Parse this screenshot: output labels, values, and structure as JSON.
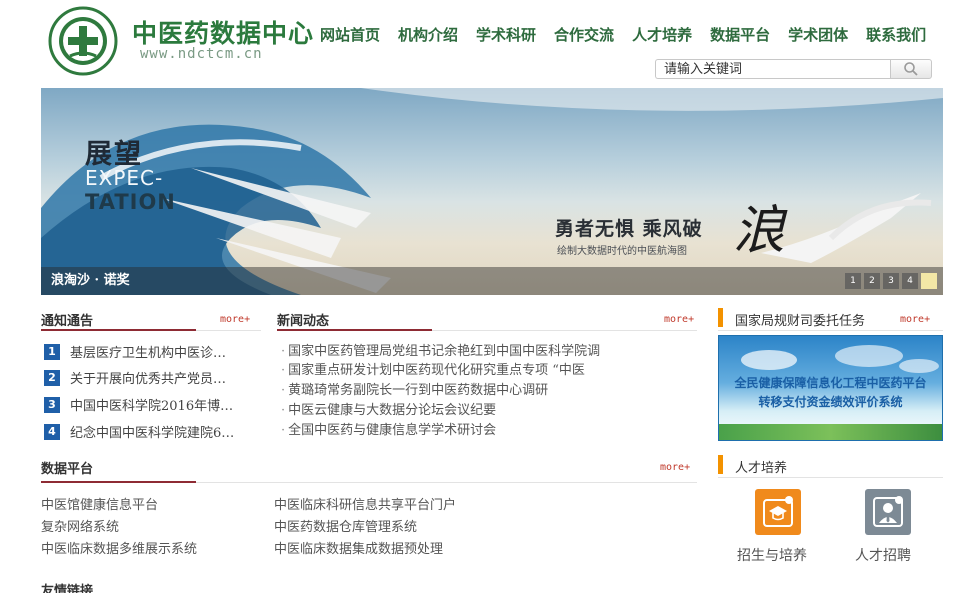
{
  "site": {
    "name": "中医药数据中心",
    "url": "www.ndctcm.cn"
  },
  "nav": [
    "网站首页",
    "机构介绍",
    "学术科研",
    "合作交流",
    "人才培养",
    "数据平台",
    "学术团体",
    "联系我们"
  ],
  "search": {
    "placeholder": "请输入关键词"
  },
  "banner": {
    "title_zh": "展望",
    "title_en_1": "EXPEC-",
    "title_en_2": "TATION",
    "slogan": "勇者无惧 乘风破",
    "callig": "浪",
    "subtitle": "绘制大数据时代的中医航海图",
    "caption": "浪淘沙 · 诺奖",
    "pages": [
      "1",
      "2",
      "3",
      "4",
      ""
    ],
    "active_page_index": 4
  },
  "notices": {
    "title": "通知通告",
    "more": "more+",
    "items": [
      {
        "num": "1",
        "text": "基层医疗卫生机构中医诊…"
      },
      {
        "num": "2",
        "text": "关于开展向优秀共产党员…"
      },
      {
        "num": "3",
        "text": "中国中医科学院2016年博…"
      },
      {
        "num": "4",
        "text": "纪念中国中医科学院建院6…"
      }
    ]
  },
  "news": {
    "title": "新闻动态",
    "more": "more+",
    "items": [
      "国家中医药管理局党组书记余艳红到中国中医科学院调",
      "国家重点研发计划中医药现代化研究重点专项 “中医",
      "黄璐琦常务副院长一行到中医药数据中心调研",
      "中医云健康与大数据分论坛会议纪要",
      "全国中医药与健康信息学学术研讨会"
    ]
  },
  "platforms": {
    "title": "数据平台",
    "more": "more+",
    "left": [
      "中医馆健康信息平台",
      "复杂网络系统",
      "中医临床数据多维展示系统"
    ],
    "right": [
      "中医临床科研信息共享平台门户",
      "中医药数据仓库管理系统",
      "中医临床数据集成数据预处理"
    ]
  },
  "friend_links": {
    "title": "友情链接"
  },
  "tasks": {
    "title": "国家局规财司委托任务",
    "more": "more+",
    "promo_line1": "全民健康保障信息化工程中医药平台",
    "promo_line2": "转移支付资金绩效评价系统"
  },
  "talent": {
    "title": "人才培养",
    "items": [
      {
        "label": "招生与培养",
        "icon": "graduation-cap-icon",
        "color": "#f08a1c"
      },
      {
        "label": "人才招聘",
        "icon": "person-tie-icon",
        "color": "#7d8a95"
      }
    ]
  }
}
